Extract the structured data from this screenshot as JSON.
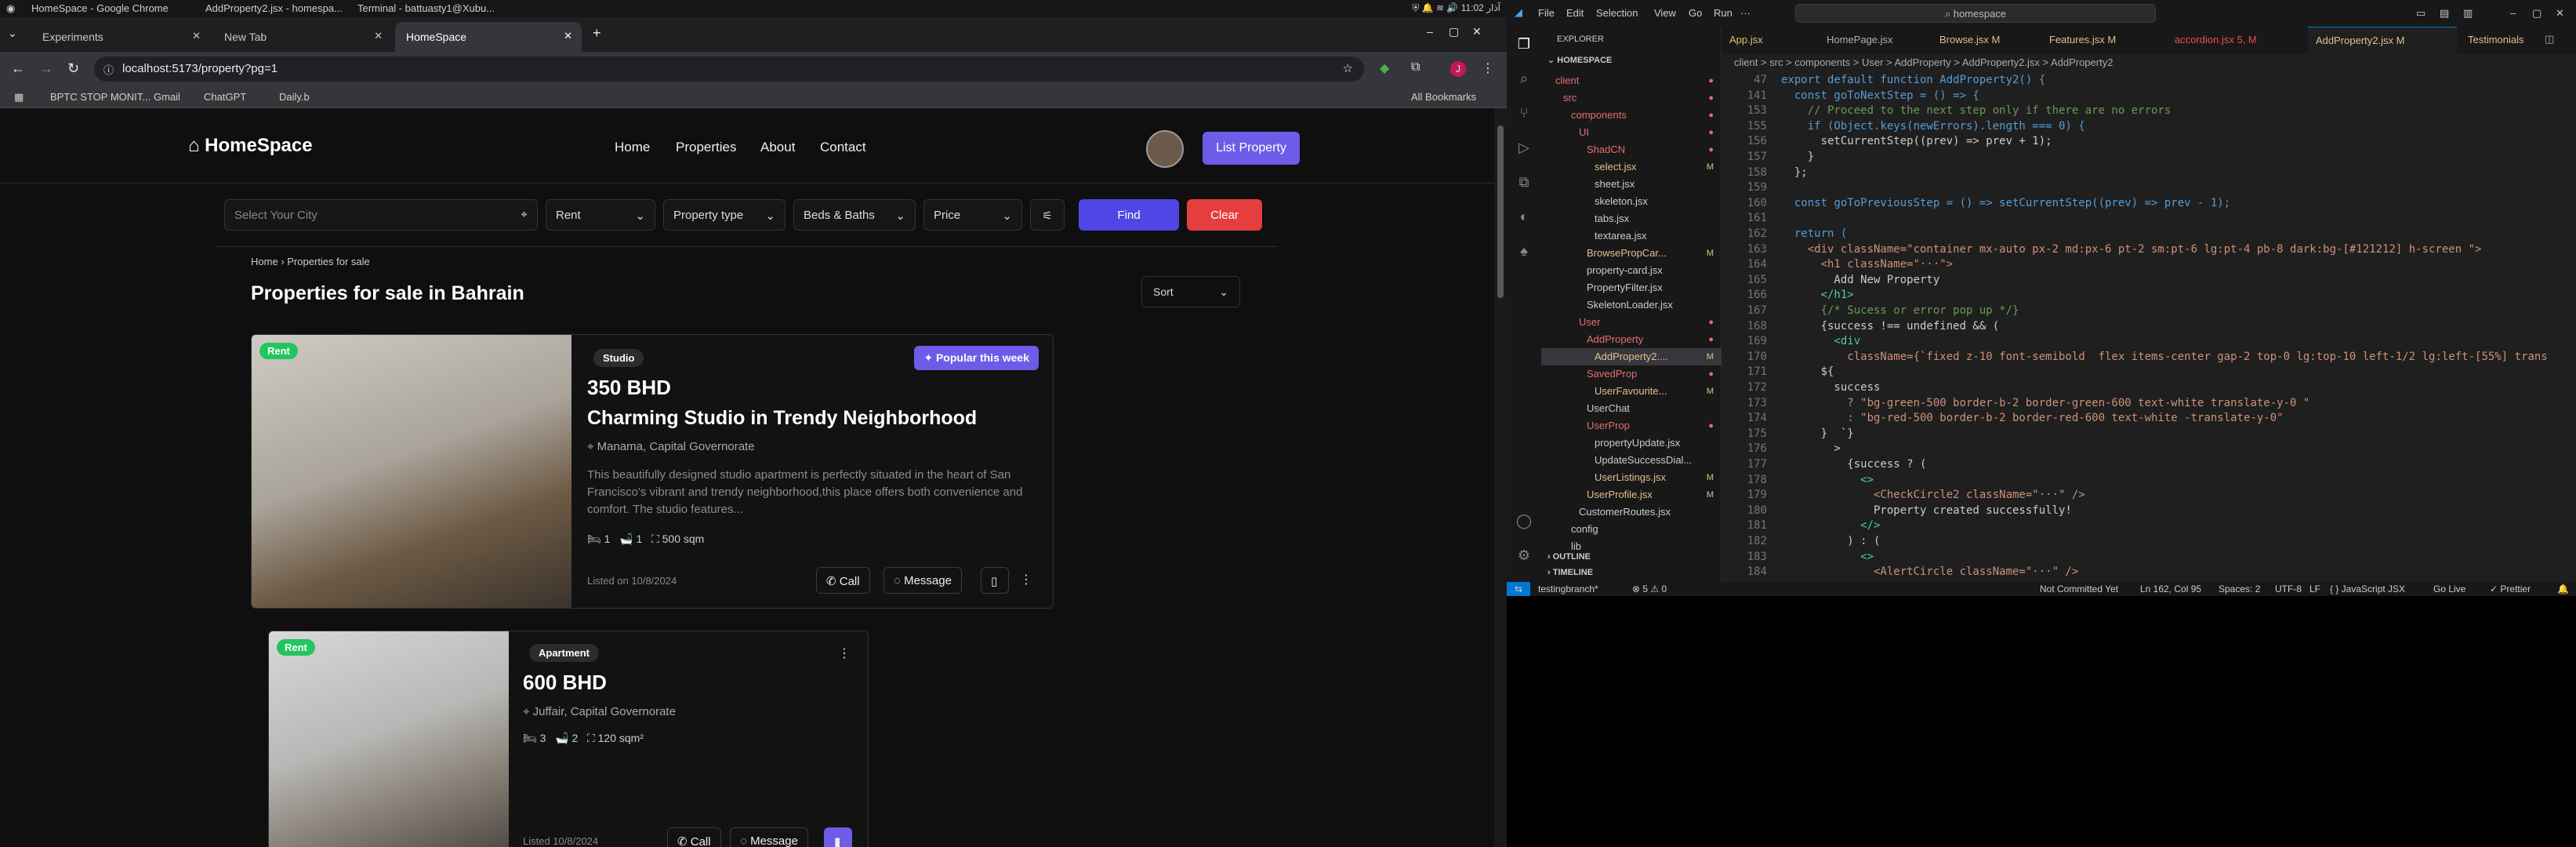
{
  "system": {
    "tasks": [
      "HomeSpace - Google Chrome",
      "AddProperty2.jsx - homespa...",
      "Terminal - battuasty1@Xubu..."
    ],
    "clock": "11:02 آذار"
  },
  "browser": {
    "tabs": [
      {
        "label": "Experiments"
      },
      {
        "label": "New Tab"
      },
      {
        "label": "HomeSpace"
      }
    ],
    "url": "localhost:5173/property?pg=1",
    "bookmarks": [
      "BPTC STOP MONIT...",
      "Gmail",
      "ChatGPT",
      "Daily.b"
    ],
    "all_bookmarks": "All Bookmarks"
  },
  "site": {
    "brand": "HomeSpace",
    "nav": [
      "Home",
      "Properties",
      "About",
      "Contact"
    ],
    "list_property": "List Property",
    "filters": {
      "city_placeholder": "Select Your City",
      "rent": "Rent",
      "property_type": "Property type",
      "beds_baths": "Beds & Baths",
      "price": "Price",
      "find": "Find",
      "clear": "Clear"
    },
    "breadcrumb": {
      "home": "Home",
      "current": "Properties for sale"
    },
    "page_title": "Properties for sale in Bahrain",
    "sort": "Sort",
    "listings": [
      {
        "badge": "Rent",
        "type": "Studio",
        "popular": "Popular this week",
        "price": "350 BHD",
        "title": "Charming Studio in Trendy Neighborhood",
        "location": "Manama, Capital Governorate",
        "description": "This beautifully designed studio apartment is perfectly situated in the heart of San Francisco's vibrant and trendy neighborhood,this place offers both convenience and comfort. The studio features...",
        "beds": "1",
        "baths": "1",
        "area": "500 sqm",
        "listed": "Listed on 10/8/2024",
        "call": "Call",
        "message": "Message"
      },
      {
        "badge": "Rent",
        "type": "Apartment",
        "price": "600 BHD",
        "location": "Juffair, Capital Governorate",
        "beds": "3",
        "baths": "2",
        "area": "120 sqm²",
        "listed": "Listed 10/8/2024",
        "call": "Call",
        "message": "Message"
      }
    ]
  },
  "vscode": {
    "menus": [
      "File",
      "Edit",
      "Selection",
      "View",
      "Go",
      "Run"
    ],
    "command_center": "homespace",
    "explorer_title": "EXPLORER",
    "root": "HOMESPACE",
    "tree": [
      {
        "label": "client",
        "depth": 1,
        "mark": "●",
        "color": "#e37070"
      },
      {
        "label": "src",
        "depth": 2,
        "mark": "●",
        "color": "#e37070"
      },
      {
        "label": "components",
        "depth": 3,
        "mark": "●",
        "color": "#e37070"
      },
      {
        "label": "UI",
        "depth": 4,
        "mark": "●",
        "color": "#e37070"
      },
      {
        "label": "ShadCN",
        "depth": 5,
        "mark": "●",
        "color": "#e37070"
      },
      {
        "label": "select.jsx",
        "depth": 6,
        "mark": "M",
        "color": "#e2c08d"
      },
      {
        "label": "sheet.jsx",
        "depth": 6,
        "mark": "",
        "color": "#cccccc"
      },
      {
        "label": "skeleton.jsx",
        "depth": 6,
        "mark": "",
        "color": "#cccccc"
      },
      {
        "label": "tabs.jsx",
        "depth": 6,
        "mark": "",
        "color": "#cccccc"
      },
      {
        "label": "textarea.jsx",
        "depth": 6,
        "mark": "",
        "color": "#cccccc"
      },
      {
        "label": "BrowsePropCar...",
        "depth": 5,
        "mark": "M",
        "color": "#e2c08d"
      },
      {
        "label": "property-card.jsx",
        "depth": 5,
        "mark": "",
        "color": "#cccccc"
      },
      {
        "label": "PropertyFilter.jsx",
        "depth": 5,
        "mark": "",
        "color": "#cccccc"
      },
      {
        "label": "SkeletonLoader.jsx",
        "depth": 5,
        "mark": "",
        "color": "#cccccc"
      },
      {
        "label": "User",
        "depth": 4,
        "mark": "●",
        "color": "#e37070"
      },
      {
        "label": "AddProperty",
        "depth": 5,
        "mark": "●",
        "color": "#e37070"
      },
      {
        "label": "AddProperty2....",
        "depth": 6,
        "mark": "M",
        "color": "#e2c08d"
      },
      {
        "label": "SavedProp",
        "depth": 5,
        "mark": "●",
        "color": "#e37070"
      },
      {
        "label": "UserFavourite...",
        "depth": 6,
        "mark": "M",
        "color": "#e2c08d"
      },
      {
        "label": "UserChat",
        "depth": 5,
        "mark": "",
        "color": "#cccccc"
      },
      {
        "label": "UserProp",
        "depth": 5,
        "mark": "●",
        "color": "#e37070"
      },
      {
        "label": "propertyUpdate.jsx",
        "depth": 6,
        "mark": "",
        "color": "#cccccc"
      },
      {
        "label": "UpdateSuccessDial...",
        "depth": 6,
        "mark": "",
        "color": "#cccccc"
      },
      {
        "label": "UserListings.jsx",
        "depth": 6,
        "mark": "M",
        "color": "#e2c08d"
      },
      {
        "label": "UserProfile.jsx",
        "depth": 5,
        "mark": "M",
        "color": "#e2c08d"
      },
      {
        "label": "CustomerRoutes.jsx",
        "depth": 4,
        "mark": "",
        "color": "#cccccc"
      },
      {
        "label": "config",
        "depth": 3,
        "mark": "",
        "color": "#cccccc"
      },
      {
        "label": "lib",
        "depth": 3,
        "mark": "",
        "color": "#cccccc"
      }
    ],
    "outline": "OUTLINE",
    "timeline": "TIMELINE",
    "tabs": [
      "App.jsx",
      "HomePage.jsx",
      "Browse.jsx M",
      "Features.jsx M",
      "accordion.jsx 5, M",
      "AddProperty2.jsx M",
      "Testimonials"
    ],
    "breadcrumb": "client > src > components > User > AddProperty > AddProperty2.jsx > AddProperty2",
    "code": [
      {
        "n": "47",
        "t": "export default function AddProperty2() {"
      },
      {
        "n": "141",
        "t": "  const goToNextStep = () => {"
      },
      {
        "n": "153",
        "t": "    // Proceed to the next step only if there are no errors"
      },
      {
        "n": "155",
        "t": "    if (Object.keys(newErrors).length === 0) {"
      },
      {
        "n": "156",
        "t": "      setCurrentStep((prev) => prev + 1);"
      },
      {
        "n": "157",
        "t": "    }"
      },
      {
        "n": "158",
        "t": "  };"
      },
      {
        "n": "159",
        "t": ""
      },
      {
        "n": "160",
        "t": "  const goToPreviousStep = () => setCurrentStep((prev) => prev - 1);"
      },
      {
        "n": "161",
        "t": ""
      },
      {
        "n": "162",
        "t": "  return ("
      },
      {
        "n": "163",
        "t": "    <div className=\"container mx-auto px-2 md:px-6 pt-2 sm:pt-6 lg:pt-4 pb-8 dark:bg-[#121212] h-screen \">"
      },
      {
        "n": "164",
        "t": "      <h1 className=\"···\">"
      },
      {
        "n": "165",
        "t": "        Add New Property"
      },
      {
        "n": "166",
        "t": "      </h1>"
      },
      {
        "n": "167",
        "t": "      {/* Sucess or error pop up */}"
      },
      {
        "n": "168",
        "t": "      {success !== undefined && ("
      },
      {
        "n": "169",
        "t": "        <div"
      },
      {
        "n": "170",
        "t": "          className={`fixed z-10 font-semibold  flex items-center gap-2 top-0 lg:top-10 left-1/2 lg:left-[55%] trans"
      },
      {
        "n": "171",
        "t": "      ${"
      },
      {
        "n": "172",
        "t": "        success"
      },
      {
        "n": "173",
        "t": "          ? \"bg-green-500 border-b-2 border-green-600 text-white translate-y-0 \""
      },
      {
        "n": "174",
        "t": "          : \"bg-red-500 border-b-2 border-red-600 text-white -translate-y-0\""
      },
      {
        "n": "175",
        "t": "      }  `}"
      },
      {
        "n": "176",
        "t": "        >"
      },
      {
        "n": "177",
        "t": "          {success ? ("
      },
      {
        "n": "178",
        "t": "            <>"
      },
      {
        "n": "179",
        "t": "              <CheckCircle2 className=\"···\" />"
      },
      {
        "n": "180",
        "t": "              Property created successfully!"
      },
      {
        "n": "181",
        "t": "            </>"
      },
      {
        "n": "182",
        "t": "          ) : ("
      },
      {
        "n": "183",
        "t": "            <>"
      },
      {
        "n": "184",
        "t": "              <AlertCircle className=\"···\" />"
      }
    ],
    "status": {
      "branch": "testingbranch*",
      "problems": "⊗ 5 ⚠ 0",
      "commit": "Not Committed Yet",
      "position": "Ln 162, Col 95",
      "spaces": "Spaces: 2",
      "encoding": "UTF-8",
      "eol": "LF",
      "language": "{ } JavaScript JSX",
      "golive": "Go Live",
      "prettier": "✓ Prettier"
    },
    "accent": "#0078d4"
  }
}
